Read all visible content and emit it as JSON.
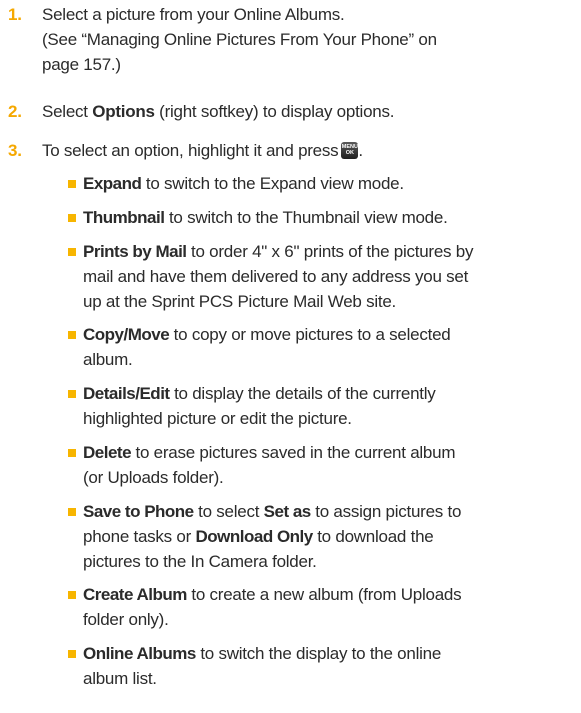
{
  "steps": [
    {
      "number": "1.",
      "lines": [
        "Select a picture from your Online Albums.",
        "(See “Managing Online Pictures From Your Phone” on",
        "page 157.)"
      ]
    },
    {
      "number": "2.",
      "pre": "Select ",
      "bold": "Options",
      "post": " (right softkey) to display options."
    },
    {
      "number": "3.",
      "text": "To select an option, highlight it and press",
      "key_top": "MENU",
      "key_bottom": "OK",
      "after_key": "."
    }
  ],
  "options": [
    {
      "name": "Expand",
      "lines": [
        "to switch to the Expand view mode."
      ]
    },
    {
      "name": "Thumbnail",
      "lines": [
        "to switch to the Thumbnail view mode."
      ]
    },
    {
      "name": "Prints by Mail",
      "lines": [
        "to order 4\" x 6\" prints of the pictures by",
        "mail and have them delivered to any address you set",
        "up at the Sprint PCS Picture Mail Web site."
      ]
    },
    {
      "name": "Copy/Move",
      "lines": [
        "to copy or move pictures to a selected",
        "album."
      ]
    },
    {
      "name": "Details/Edit",
      "lines": [
        "to display the details of the currently",
        "highlighted picture or edit the picture."
      ]
    },
    {
      "name": "Delete",
      "lines": [
        "to erase pictures saved in the current album",
        "(or Uploads folder)."
      ]
    },
    {
      "name": "Save to Phone",
      "line1_a": "to select ",
      "set_as": "Set as",
      "line1_b": " to assign pictures to",
      "line2_a": "phone tasks or ",
      "download_only": "Download Only",
      "line2_b": " to download the",
      "line3": "pictures to the In Camera folder."
    },
    {
      "name": "Create Album",
      "lines": [
        "to create a new album (from Uploads",
        "folder only)."
      ]
    },
    {
      "name": "Online Albums",
      "lines": [
        "to switch the display to the online",
        "album list."
      ]
    }
  ]
}
